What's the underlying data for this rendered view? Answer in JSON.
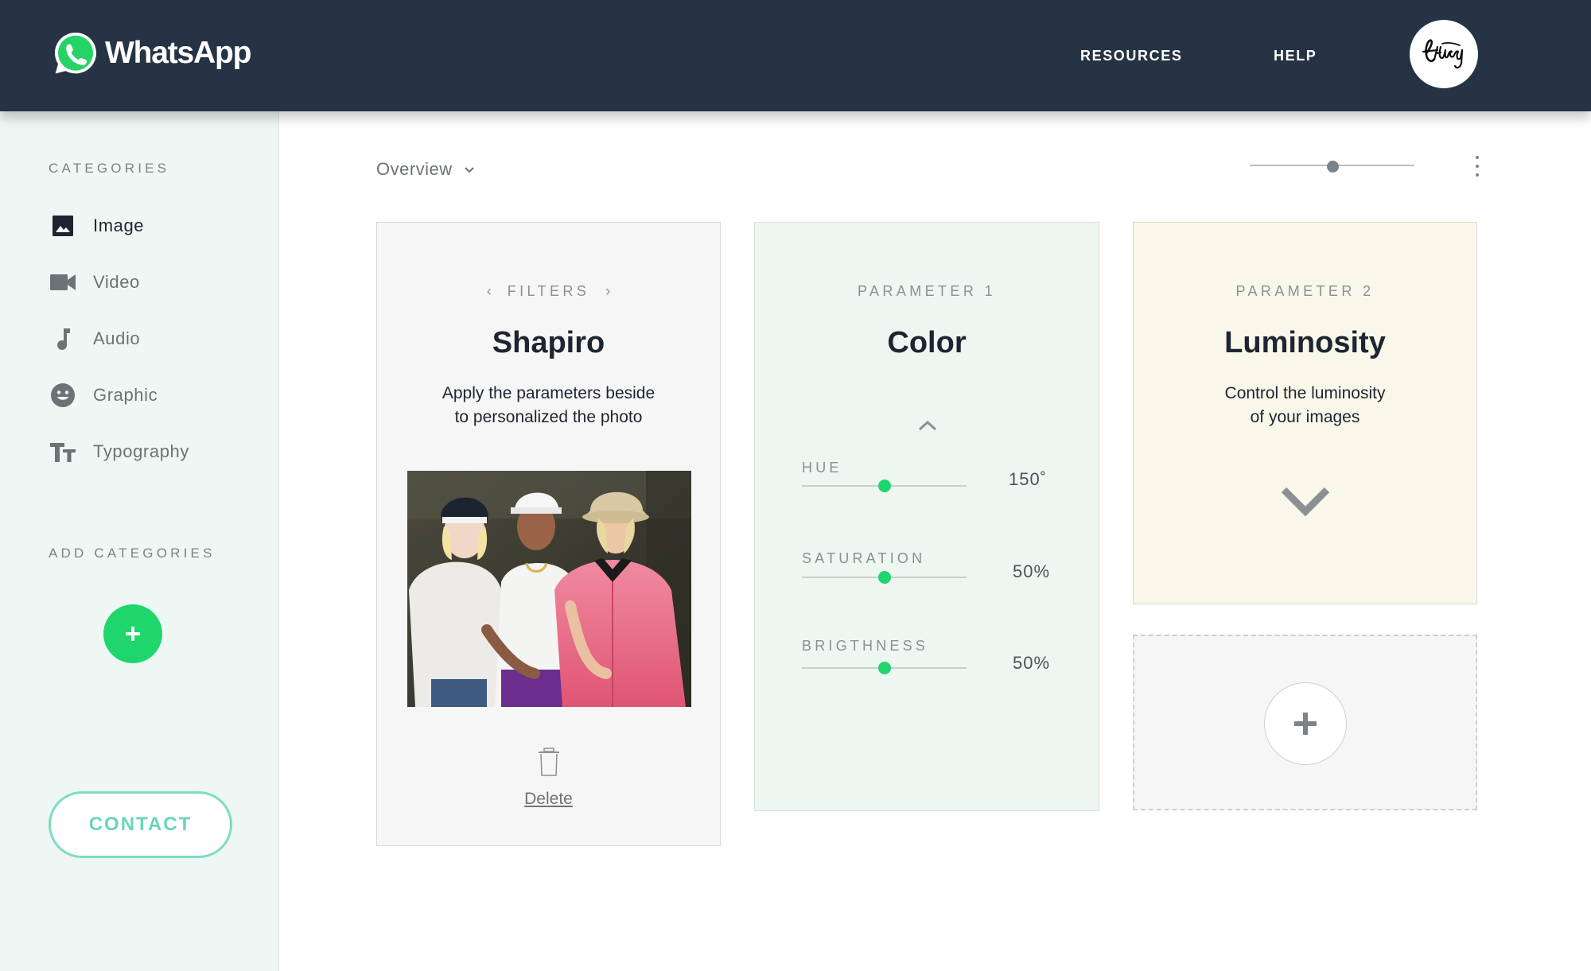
{
  "header": {
    "brand": "WhatsApp",
    "nav": [
      "RESOURCES",
      "HELP"
    ],
    "brand_color": "#25D366",
    "background": "#253345"
  },
  "sidebar": {
    "categories_heading": "CATEGORIES",
    "items": [
      {
        "label": "Image",
        "icon": "image-icon",
        "active": true
      },
      {
        "label": "Video",
        "icon": "video-icon",
        "active": false
      },
      {
        "label": "Audio",
        "icon": "music-note-icon",
        "active": false
      },
      {
        "label": "Graphic",
        "icon": "smiley-icon",
        "active": false
      },
      {
        "label": "Typography",
        "icon": "text-size-icon",
        "active": false
      }
    ],
    "add_heading": "ADD CATEGORIES",
    "contact_label": "CONTACT",
    "accent": "#1ED66B"
  },
  "toolbar": {
    "view_label": "Overview",
    "zoom_level": 0.5
  },
  "filters_card": {
    "kicker": "FILTERS",
    "title": "Shapiro",
    "description_line1": "Apply the parameters beside",
    "description_line2": "to personalized the photo",
    "delete_label": "Delete"
  },
  "color_card": {
    "kicker": "PARAMETER 1",
    "title": "Color",
    "params": [
      {
        "label": "HUE",
        "value": "150˚",
        "level": 0.5
      },
      {
        "label": "SATURATION",
        "value": "50%",
        "level": 0.5
      },
      {
        "label": "BRIGTHNESS",
        "value": "50%",
        "level": 0.5
      }
    ]
  },
  "luminosity_card": {
    "kicker": "PARAMETER 2",
    "title": "Luminosity",
    "description_line1": "Control the luminosity",
    "description_line2": "of your images"
  }
}
